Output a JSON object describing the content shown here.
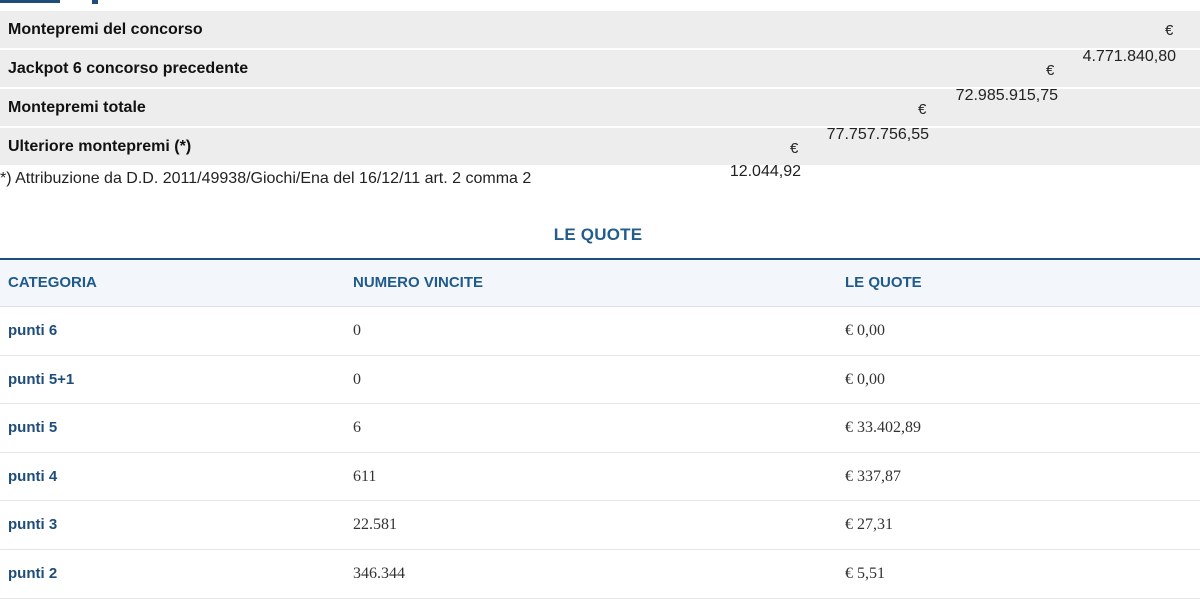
{
  "montepremi": [
    {
      "label": "Montepremi del concorso",
      "currency": "€",
      "value": "4.771.840,80"
    },
    {
      "label": "Jackpot 6 concorso precedente",
      "currency": "€",
      "value": "72.985.915,75"
    },
    {
      "label": "Montepremi totale",
      "currency": "€",
      "value": "77.757.756,55"
    },
    {
      "label": "Ulteriore montepremi (*)",
      "currency": "€",
      "value": "12.044,92"
    }
  ],
  "note": "*) Attribuzione da D.D. 2011/49938/Giochi/Ena del 16/12/11 art. 2 comma 2",
  "quote_title": "LE QUOTE",
  "quote_headers": {
    "categoria": "CATEGORIA",
    "numero_vincite": "NUMERO VINCITE",
    "quote": "LE QUOTE"
  },
  "quote_rows": [
    {
      "categoria": "punti 6",
      "numero": "0",
      "quota": "€ 0,00"
    },
    {
      "categoria": "punti 5+1",
      "numero": "0",
      "quota": "€ 0,00"
    },
    {
      "categoria": "punti 5",
      "numero": "6",
      "quota": "€ 33.402,89"
    },
    {
      "categoria": "punti 4",
      "numero": "611",
      "quota": "€ 337,87"
    },
    {
      "categoria": "punti 3",
      "numero": "22.581",
      "quota": "€ 27,31"
    },
    {
      "categoria": "punti 2",
      "numero": "346.344",
      "quota": "€ 5,51"
    }
  ]
}
